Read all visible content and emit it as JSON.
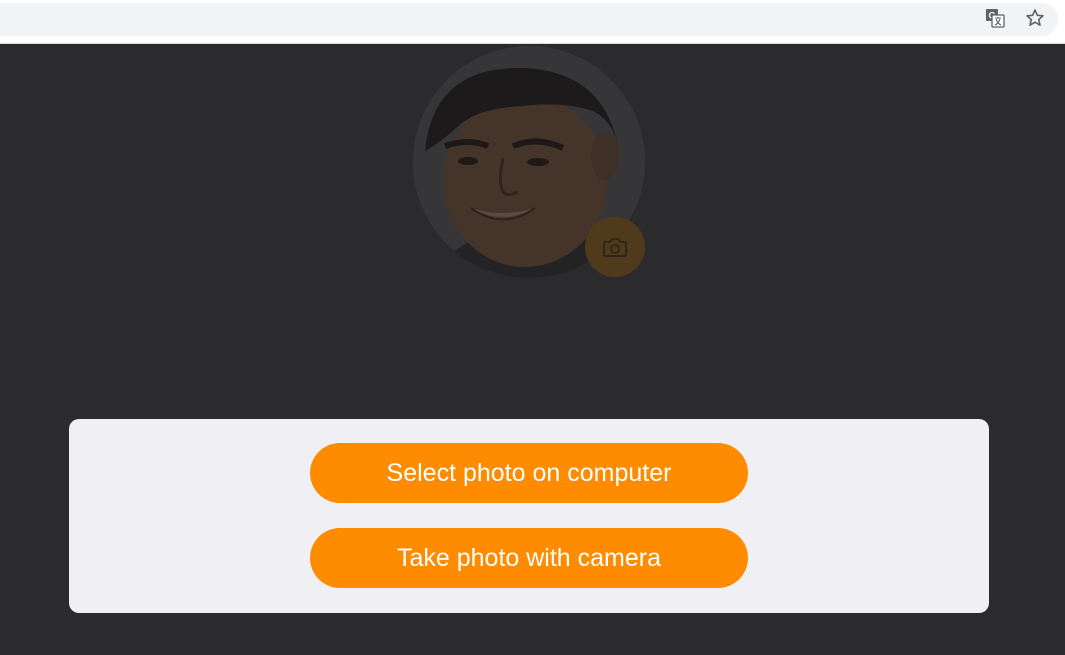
{
  "browser": {
    "icons": [
      "translate-icon",
      "star-icon"
    ]
  },
  "profile": {
    "avatar_icon": "user-photo",
    "camera_icon": "camera-icon"
  },
  "sheet": {
    "select_label": "Select photo on computer",
    "camera_label": "Take photo with camera"
  },
  "colors": {
    "accent": "#ff8c00",
    "overlay_bg": "#2b2b2d",
    "sheet_bg": "#efeff4",
    "omnibox_bg": "#f1f3f4"
  }
}
